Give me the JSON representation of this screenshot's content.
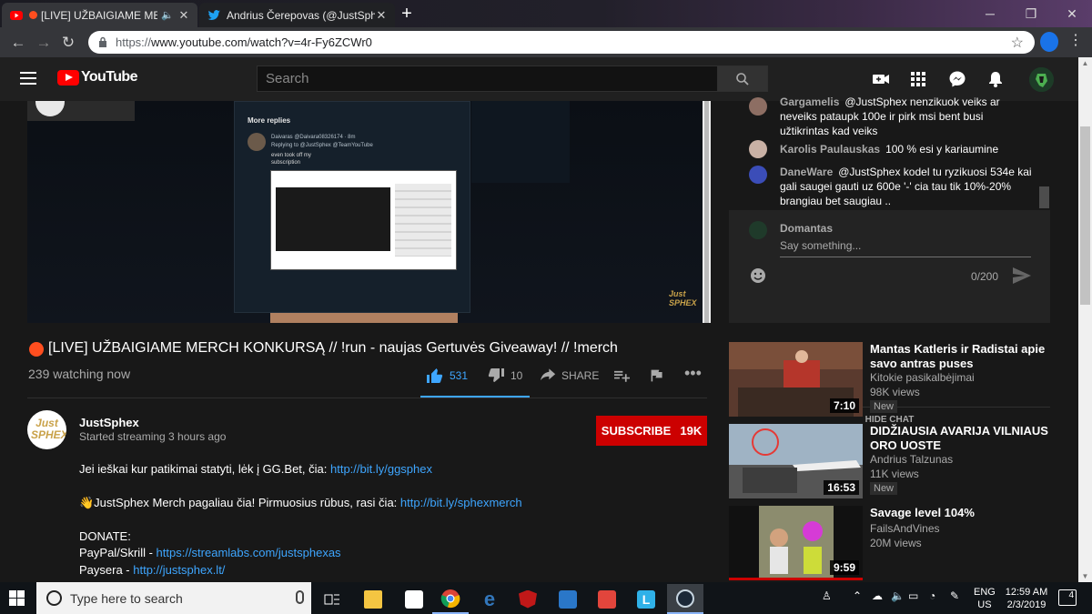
{
  "browser": {
    "tabs": [
      {
        "title": "[LIVE] UŽBAIGIAME MERC",
        "favicon": "youtube-icon",
        "muted": true
      },
      {
        "title": "Andrius Čerepovas (@JustSphex)",
        "favicon": "twitter-icon"
      }
    ],
    "url_scheme": "https://",
    "url_rest": "www.youtube.com/watch?v=4r-Fy6ZCWr0"
  },
  "masthead": {
    "logo_text": "YouTube",
    "search_placeholder": "Search"
  },
  "video": {
    "title": "[LIVE] UŽBAIGIAME MERCH KONKURSĄ // !run - naujas Gertuvės Giveaway! // !merch",
    "views": "239 watching now",
    "likes": "531",
    "dislikes": "10",
    "share_label": "SHARE",
    "player": {
      "panel_heading": "More replies",
      "tweet_user": "Daivaras @Daivara08326174 · 8m",
      "tweet_reply": "Replying to @JustSphex @TeamYouTube",
      "tweet_body_1": "even took off my",
      "tweet_body_2": "subscription",
      "watermark": "Just SPHEX"
    }
  },
  "channel": {
    "name": "JustSphex",
    "meta": "Started streaming 3 hours ago",
    "avatar_text": "Just SPHEX",
    "subscribe_label": "SUBSCRIBE",
    "subscriber_count": "19K"
  },
  "description": {
    "line1_text": "Jei ieškai kur patikimai statyti, lėk į GG.Bet, čia: ",
    "line1_link": "http://bit.ly/ggsphex",
    "line2_text": "👋JustSphex Merch pagaliau čia! Pirmuosius rūbus, rasi čia: ",
    "line2_link": "http://bit.ly/sphexmerch",
    "donate_heading": "DONATE:",
    "paypal_text": "PayPal/Skrill - ",
    "paypal_link": "https://streamlabs.com/justsphexas",
    "paysera_text": "Paysera - ",
    "paysera_link": "http://justsphex.lt/"
  },
  "chat": {
    "messages": [
      {
        "author": "Gargamelis",
        "text": "@JustSphex nenzikuok veiks ar neveiks pataupk 100e ir pirk msi bent busi užtikrintas kad veiks"
      },
      {
        "author": "Karolis Paulauskas",
        "text": "100 % esi y kariaumine"
      },
      {
        "author": "DaneWare",
        "text": "@JustSphex kodel tu ryzikuosi 534e kai gali saugei gauti uz 600e '-' cia tau tik 10%-20% brangiau bet saugiau .."
      }
    ],
    "self_name": "Domantas",
    "input_placeholder": "Say something...",
    "char_count": "0/200",
    "hide_label": "HIDE CHAT"
  },
  "recommendations": [
    {
      "title": "Mantas Katleris ir Radistai apie savo antras puses",
      "channel": "Kitokie pasikalbėjimai",
      "views": "98K views",
      "badge": "New",
      "duration": "7:10"
    },
    {
      "title": "DIDŽIAUSIA AVARIJA VILNIAUS ORO UOSTE",
      "channel": "Andrius Talzunas",
      "views": "11K views",
      "badge": "New",
      "duration": "16:53"
    },
    {
      "title": "Savage level 104%",
      "channel": "FailsAndVines",
      "views": "20M views",
      "badge": "",
      "duration": "9:59"
    }
  ],
  "taskbar": {
    "search_placeholder": "Type here to search",
    "lang": "ENG",
    "region": "US",
    "time": "12:59 AM",
    "date": "2/3/2019",
    "notifications": "4"
  },
  "colors": {
    "youtube_red": "#ff0000",
    "subscribe_red": "#cc0000",
    "link_blue": "#3ea6ff",
    "live_dot": "#ff4e1f"
  }
}
